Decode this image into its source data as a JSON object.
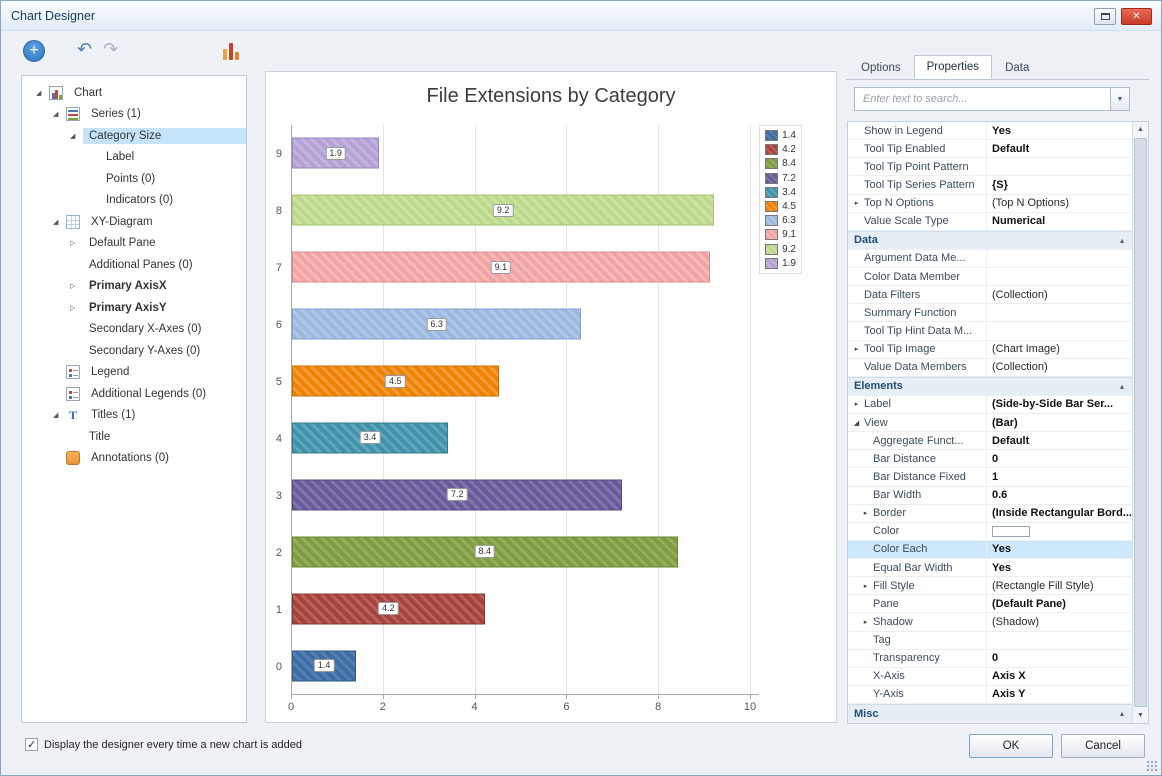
{
  "window": {
    "title": "Chart Designer"
  },
  "icons": {
    "close": "✕",
    "plus": "+",
    "undo": "↶",
    "redo": "↷",
    "chevron_down": "▼",
    "scroll_up": "▲",
    "scroll_down": "▼",
    "tree_expanded": "◢",
    "tree_collapsed": "▷",
    "prop_expanded": "◢",
    "prop_collapsed": "▸",
    "category_collapse": "▴"
  },
  "tree": {
    "items": [
      {
        "label": "Chart",
        "level": 0,
        "expand": "expanded",
        "icon": "chart"
      },
      {
        "label": "Series (1)",
        "level": 1,
        "expand": "expanded",
        "icon": "series"
      },
      {
        "label": "Category Size",
        "level": 2,
        "expand": "expanded",
        "selected": true
      },
      {
        "label": "Label",
        "level": 3
      },
      {
        "label": "Points (0)",
        "level": 3
      },
      {
        "label": "Indicators (0)",
        "level": 3
      },
      {
        "label": "XY-Diagram",
        "level": 1,
        "expand": "expanded",
        "icon": "diagram"
      },
      {
        "label": "Default Pane",
        "level": 2,
        "expand": "collapsed"
      },
      {
        "label": "Additional Panes (0)",
        "level": 2
      },
      {
        "label": "Primary AxisX",
        "level": 2,
        "expand": "collapsed",
        "bold": true
      },
      {
        "label": "Primary AxisY",
        "level": 2,
        "expand": "collapsed",
        "bold": true
      },
      {
        "label": "Secondary X-Axes (0)",
        "level": 2
      },
      {
        "label": "Secondary Y-Axes (0)",
        "level": 2
      },
      {
        "label": "Legend",
        "level": 1,
        "icon": "legend"
      },
      {
        "label": "Additional Legends (0)",
        "level": 1,
        "icon": "legend"
      },
      {
        "label": "Titles (1)",
        "level": 1,
        "expand": "expanded",
        "icon": "title"
      },
      {
        "label": "Title",
        "level": 2
      },
      {
        "label": "Annotations (0)",
        "level": 1,
        "icon": "annotation"
      }
    ]
  },
  "chart_data": {
    "type": "bar",
    "orientation": "horizontal",
    "title": "File Extensions by Category",
    "categories": [
      "0",
      "1",
      "2",
      "3",
      "4",
      "5",
      "6",
      "7",
      "8",
      "9"
    ],
    "values": [
      1.4,
      4.2,
      8.4,
      7.2,
      3.4,
      4.5,
      6.3,
      9.1,
      9.2,
      1.9
    ],
    "bar_labels": [
      "1.4",
      "4.2",
      "8.4",
      "7.2",
      "3.4",
      "4.5",
      "6.3",
      "9.1",
      "9.2",
      "1.9"
    ],
    "colors": [
      "#3a6ea5",
      "#a5423c",
      "#7e9d3e",
      "#685a9b",
      "#3e93ab",
      "#ef8200",
      "#9bb9e0",
      "#f2a3a3",
      "#bcd98a",
      "#b5a1d6"
    ],
    "stripe_colors": [
      "#587fae",
      "#b6625c",
      "#95ad60",
      "#8076ac",
      "#61a6ba",
      "#f39b38",
      "#aec7e7",
      "#f6baba",
      "#cbe2a4",
      "#c3b3dd"
    ],
    "border_colors": [
      "#2d5a8a",
      "#8a342f",
      "#688430",
      "#544780",
      "#2f7a90",
      "#c96e00",
      "#7fa1cd",
      "#da8989",
      "#a3c46e",
      "#9a86c1"
    ],
    "xlim": [
      0,
      10
    ],
    "x_ticks": [
      0,
      2,
      4,
      6,
      8,
      10
    ],
    "legend_labels": [
      "1.4",
      "4.2",
      "8.4",
      "7.2",
      "3.4",
      "4.5",
      "6.3",
      "9.1",
      "9.2",
      "1.9"
    ],
    "legend_position": "top-right",
    "grid": true,
    "category_order_top_to_bottom": [
      "9",
      "8",
      "7",
      "6",
      "5",
      "4",
      "3",
      "2",
      "1",
      "0"
    ]
  },
  "right_panel": {
    "tabs": [
      {
        "label": "Options",
        "active": false
      },
      {
        "label": "Properties",
        "active": true
      },
      {
        "label": "Data",
        "active": false
      }
    ],
    "search_placeholder": "Enter text to search...",
    "properties": [
      {
        "name": "Show in Legend",
        "value": "Yes",
        "bold": true
      },
      {
        "name": "Tool Tip Enabled",
        "value": "Default",
        "bold": true
      },
      {
        "name": "Tool Tip Point Pattern",
        "value": ""
      },
      {
        "name": "Tool Tip Series Pattern",
        "value": "{S}",
        "bold": true
      },
      {
        "name": "Top N Options",
        "value": "(Top N Options)",
        "arrow": "collapsed"
      },
      {
        "name": "Value Scale Type",
        "value": "Numerical",
        "bold": true
      },
      {
        "category": "Data"
      },
      {
        "name": "Argument Data Me...",
        "value": ""
      },
      {
        "name": "Color Data Member",
        "value": ""
      },
      {
        "name": "Data Filters",
        "value": "(Collection)"
      },
      {
        "name": "Summary Function",
        "value": ""
      },
      {
        "name": "Tool Tip Hint Data M...",
        "value": ""
      },
      {
        "name": "Tool Tip Image",
        "value": "(Chart Image)",
        "arrow": "collapsed"
      },
      {
        "name": "Value Data Members",
        "value": "(Collection)"
      },
      {
        "category": "Elements"
      },
      {
        "name": "Label",
        "value": "(Side-by-Side Bar Ser...",
        "arrow": "collapsed",
        "bold": true
      },
      {
        "name": "View",
        "value": "(Bar)",
        "arrow": "expanded",
        "bold": true
      },
      {
        "name": "Aggregate Funct...",
        "value": "Default",
        "indent": 1,
        "bold": true
      },
      {
        "name": "Bar Distance",
        "value": "0",
        "indent": 1,
        "bold": true
      },
      {
        "name": "Bar Distance Fixed",
        "value": "1",
        "indent": 1,
        "bold": true
      },
      {
        "name": "Bar Width",
        "value": "0.6",
        "indent": 1,
        "bold": true
      },
      {
        "name": "Border",
        "value": "(Inside Rectangular Bord...",
        "arrow": "collapsed",
        "indent": 1,
        "bold": true
      },
      {
        "name": "Color",
        "value": "",
        "indent": 1,
        "swatch": true
      },
      {
        "name": "Color Each",
        "value": "Yes",
        "indent": 1,
        "bold": true,
        "selected": true
      },
      {
        "name": "Equal Bar Width",
        "value": "Yes",
        "indent": 1,
        "bold": true
      },
      {
        "name": "Fill Style",
        "value": "(Rectangle Fill Style)",
        "arrow": "collapsed",
        "indent": 1
      },
      {
        "name": "Pane",
        "value": "(Default Pane)",
        "indent": 1,
        "bold": true
      },
      {
        "name": "Shadow",
        "value": "(Shadow)",
        "arrow": "collapsed",
        "indent": 1
      },
      {
        "name": "Tag",
        "value": "",
        "indent": 1
      },
      {
        "name": "Transparency",
        "value": "0",
        "indent": 1,
        "bold": true
      },
      {
        "name": "X-Axis",
        "value": "Axis X",
        "indent": 1,
        "bold": true
      },
      {
        "name": "Y-Axis",
        "value": "Axis Y",
        "indent": 1,
        "bold": true
      },
      {
        "category": "Misc"
      }
    ]
  },
  "footer": {
    "checkbox_label": "Display the designer every time a new chart is added",
    "checkbox_checked": true,
    "ok_label": "OK",
    "cancel_label": "Cancel"
  }
}
